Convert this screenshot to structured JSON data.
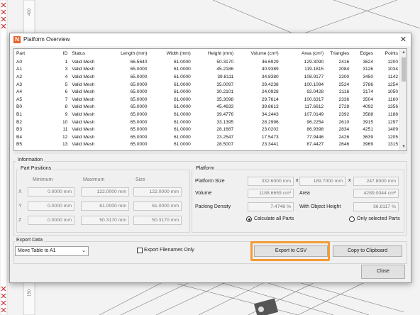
{
  "background": {
    "ruler_top_label": "400",
    "ruler_bottom_label": "150"
  },
  "dialog": {
    "title": "Platform Overview",
    "close_glyph": "✕"
  },
  "table": {
    "headers": [
      "Part",
      "ID",
      "Status",
      "Length (mm)",
      "Width (mm)",
      "Height (mm)",
      "Volume (cm³)",
      "Area (cm²)",
      "Triangles",
      "Edges",
      "Points"
    ],
    "rows": [
      [
        "A0",
        "1",
        "Valid Mesh",
        "66.5640",
        "61.0000",
        "50.3170",
        "46.6929",
        "129.3090",
        "2416",
        "3624",
        "1200"
      ],
      [
        "A1",
        "3",
        "Valid Mesh",
        "65.0000",
        "61.0000",
        "45.2186",
        "40.9389",
        "119.1815",
        "2084",
        "3126",
        "1034"
      ],
      [
        "A2",
        "4",
        "Valid Mesh",
        "65.0000",
        "61.0000",
        "39.8111",
        "34.8380",
        "108.9177",
        "2300",
        "3450",
        "1142"
      ],
      [
        "A3",
        "5",
        "Valid Mesh",
        "65.0000",
        "61.0000",
        "35.0097",
        "29.4238",
        "100.1094",
        "2524",
        "3786",
        "1254"
      ],
      [
        "A4",
        "6",
        "Valid Mesh",
        "65.0000",
        "61.0000",
        "30.2101",
        "24.0928",
        "92.0428",
        "2116",
        "3174",
        "1050"
      ],
      [
        "A5",
        "7",
        "Valid Mesh",
        "65.0000",
        "61.0000",
        "35.3098",
        "29.7614",
        "100.6317",
        "2336",
        "3504",
        "1160"
      ],
      [
        "B0",
        "8",
        "Valid Mesh",
        "65.0000",
        "61.0000",
        "45.4633",
        "39.8613",
        "117.6612",
        "2728",
        "4092",
        "1356"
      ],
      [
        "B1",
        "9",
        "Valid Mesh",
        "65.0000",
        "61.0000",
        "39.4776",
        "34.2443",
        "107.0149",
        "2392",
        "3588",
        "1188"
      ],
      [
        "B2",
        "10",
        "Valid Mesh",
        "65.0000",
        "61.0000",
        "33.1395",
        "28.2996",
        "96.2254",
        "2610",
        "3915",
        "1297"
      ],
      [
        "B3",
        "11",
        "Valid Mesh",
        "65.0000",
        "61.0000",
        "28.1687",
        "23.0202",
        "86.9398",
        "2834",
        "4251",
        "1409"
      ],
      [
        "B4",
        "12",
        "Valid Mesh",
        "65.0000",
        "61.0000",
        "23.2547",
        "17.5473",
        "77.9446",
        "2426",
        "3639",
        "1205"
      ],
      [
        "B5",
        "13",
        "Valid Mesh",
        "65.0000",
        "61.0000",
        "28.5007",
        "23.3441",
        "87.4427",
        "2646",
        "3969",
        "1315"
      ]
    ]
  },
  "information": {
    "label": "Information",
    "part_positions": {
      "label": "Part Positions",
      "col_minimum": "Minimum",
      "col_maximum": "Maximum",
      "col_size": "Size",
      "rows": [
        {
          "axis": "X",
          "min": "0.0000 mm",
          "max": "122.0000 mm",
          "size": "122.0000 mm"
        },
        {
          "axis": "Y",
          "min": "0.0000 mm",
          "max": "61.0000 mm",
          "size": "61.0000 mm"
        },
        {
          "axis": "Z",
          "min": "0.0000 mm",
          "max": "50.3170 mm",
          "size": "50.3170 mm"
        }
      ]
    },
    "platform": {
      "label": "Platform",
      "size_label": "Platform Size",
      "size_x": "332.6000 mm",
      "size_y": "189.7000 mm",
      "size_z": "247.8000 mm",
      "times": "x",
      "volume_label": "Volume",
      "volume_value": "1188.6659 cm³",
      "area_label": "Area",
      "area_value": "4289.0044 cm²",
      "packing_label": "Packing Density",
      "packing_value": "7.4748 %",
      "object_height_label": "With Object Height",
      "object_height_value": "36.8117 %",
      "radio_all": "Calculate all Parts",
      "radio_selected": "Only selected Parts"
    }
  },
  "export": {
    "label": "Export Data",
    "select_value": "Move Table to A1",
    "checkbox_label": "Export Filenames Only",
    "csv_button": "Export to CSV",
    "clipboard_button": "Copy to Clipboard",
    "close_button": "Close"
  },
  "colors": {
    "highlight": "#f39c34",
    "brand": "#e8632b"
  }
}
